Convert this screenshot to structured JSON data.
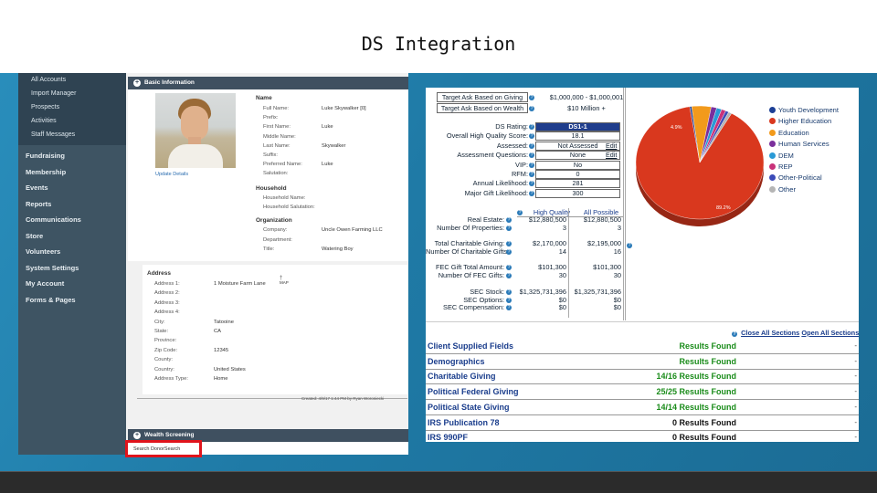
{
  "slide": {
    "title": "DS Integration"
  },
  "left_app": {
    "sub_menu": [
      "All Accounts",
      "Import Manager",
      "Prospects",
      "Activities",
      "Staff Messages"
    ],
    "nav": [
      "Fundraising",
      "Membership",
      "Events",
      "Reports",
      "Communications",
      "Store",
      "Volunteers",
      "System Settings",
      "My Account",
      "Forms & Pages"
    ],
    "basic_info_header": "Basic Information",
    "update_details": "Update Details",
    "name_section": {
      "title": "Name",
      "fields": [
        {
          "label": "Full Name:",
          "value": "Luke Skywalker [0]"
        },
        {
          "label": "Prefix:",
          "value": ""
        },
        {
          "label": "First Name:",
          "value": "Luke"
        },
        {
          "label": "Middle Name:",
          "value": ""
        },
        {
          "label": "Last Name:",
          "value": "Skywalker"
        },
        {
          "label": "Suffix:",
          "value": ""
        },
        {
          "label": "Preferred Name:",
          "value": "Luke"
        },
        {
          "label": "Salutation:",
          "value": ""
        }
      ]
    },
    "household_section": {
      "title": "Household",
      "fields": [
        {
          "label": "Household Name:",
          "value": ""
        },
        {
          "label": "Household Salutation:",
          "value": ""
        }
      ]
    },
    "organization_section": {
      "title": "Organization",
      "fields": [
        {
          "label": "Company:",
          "value": "Uncle Owen Farming LLC"
        },
        {
          "label": "Department:",
          "value": ""
        },
        {
          "label": "Title:",
          "value": "Watering Boy"
        }
      ]
    },
    "address_section": {
      "title": "Address",
      "map_label": "MAP",
      "fields": [
        {
          "label": "Address 1:",
          "value": "1 Moisture Farm Lane"
        },
        {
          "label": "Address 2:",
          "value": ""
        },
        {
          "label": "Address 3:",
          "value": ""
        },
        {
          "label": "Address 4:",
          "value": ""
        },
        {
          "label": "City:",
          "value": "Tatooine"
        },
        {
          "label": "State:",
          "value": "CA"
        },
        {
          "label": "Province:",
          "value": ""
        },
        {
          "label": "Zip Code:",
          "value": "12345"
        },
        {
          "label": "County:",
          "value": ""
        },
        {
          "label": "Country:",
          "value": "United States"
        },
        {
          "label": "Address Type:",
          "value": "Home"
        }
      ]
    },
    "created_text": "Created: 4/9/17 1:44 PM by Ryan Woroniecki",
    "wealth_screening_header": "Wealth Screening",
    "search_button": "Search DonorSearch"
  },
  "right_app": {
    "target_ask_giving_label": "Target Ask Based on Giving",
    "target_ask_giving_value": "$1,000,000 - $1,000,001",
    "target_ask_wealth_label": "Target Ask Based on Wealth",
    "target_ask_wealth_value": "$10 Million +",
    "scores": [
      {
        "label": "DS Rating:",
        "value": "DS1-1",
        "edit": ""
      },
      {
        "label": "Overall High Quality Score:",
        "value": "18.1",
        "edit": ""
      },
      {
        "label": "Assessed:",
        "value": "Not Assessed",
        "edit": "Edit"
      },
      {
        "label": "Assessment Questions:",
        "value": "None",
        "edit": "Edit"
      },
      {
        "label": "VIP:",
        "value": "No",
        "edit": ""
      },
      {
        "label": "RFM:",
        "value": "0",
        "edit": ""
      },
      {
        "label": "Annual Likelihood:",
        "value": "281",
        "edit": ""
      },
      {
        "label": "Major Gift Likelihood:",
        "value": "300",
        "edit": ""
      }
    ],
    "col_high_quality": "High Quality",
    "col_all_possible": "All Possible",
    "metrics": [
      {
        "label": "Real Estate:",
        "hq": "$12,880,500",
        "all": "$12,880,500"
      },
      {
        "label": "Number Of Properties:",
        "hq": "3",
        "all": "3"
      },
      {
        "label": "Total Charitable Giving:",
        "hq": "$2,170,000",
        "all": "$2,195,000"
      },
      {
        "label": "Number Of Charitable Gifts:",
        "hq": "14",
        "all": "16"
      },
      {
        "label": "FEC Gift Total Amount:",
        "hq": "$101,300",
        "all": "$101,300"
      },
      {
        "label": "Number Of FEC Gifts:",
        "hq": "30",
        "all": "30"
      },
      {
        "label": "SEC Stock:",
        "hq": "$1,325,731,396",
        "all": "$1,325,731,396"
      },
      {
        "label": "SEC Options:",
        "hq": "$0",
        "all": "$0"
      },
      {
        "label": "SEC Compensation:",
        "hq": "$0",
        "all": "$0"
      }
    ],
    "close_all": "Close All Sections",
    "open_all": "Open All Sections",
    "results": [
      {
        "name": "Client Supplied Fields",
        "value": "Results Found",
        "color": "#1a8c1a"
      },
      {
        "name": "Demographics",
        "value": "Results Found",
        "color": "#1a8c1a"
      },
      {
        "name": "Charitable Giving",
        "value": "14/16 Results Found",
        "color": "#1a8c1a"
      },
      {
        "name": "Political Federal Giving",
        "value": "25/25 Results Found",
        "color": "#1a8c1a"
      },
      {
        "name": "Political State Giving",
        "value": "14/14 Results Found",
        "color": "#1a8c1a"
      },
      {
        "name": "IRS Publication 78",
        "value": "0 Results Found",
        "color": "#111111"
      },
      {
        "name": "IRS 990PF",
        "value": "0 Results Found",
        "color": "#111111"
      }
    ]
  },
  "chart_data": {
    "type": "pie",
    "title": "",
    "slices": [
      {
        "name": "Youth Development",
        "value": 0.5,
        "color": "#1c3f95"
      },
      {
        "name": "Higher Education",
        "value": 89.2,
        "color": "#d9381e"
      },
      {
        "name": "Education",
        "value": 4.9,
        "color": "#f29a1c"
      },
      {
        "name": "Human Services",
        "value": 1.4,
        "color": "#7a2f9c"
      },
      {
        "name": "DEM",
        "value": 1.3,
        "color": "#2a9ad6"
      },
      {
        "name": "REP",
        "value": 1.1,
        "color": "#c8327a"
      },
      {
        "name": "Other-Political",
        "value": 0.8,
        "color": "#3b4bb8"
      },
      {
        "name": "Other",
        "value": 0.8,
        "color": "#b5b5b5"
      }
    ],
    "data_labels": [
      "4.9%",
      "89.2%"
    ],
    "legend_position": "right"
  }
}
